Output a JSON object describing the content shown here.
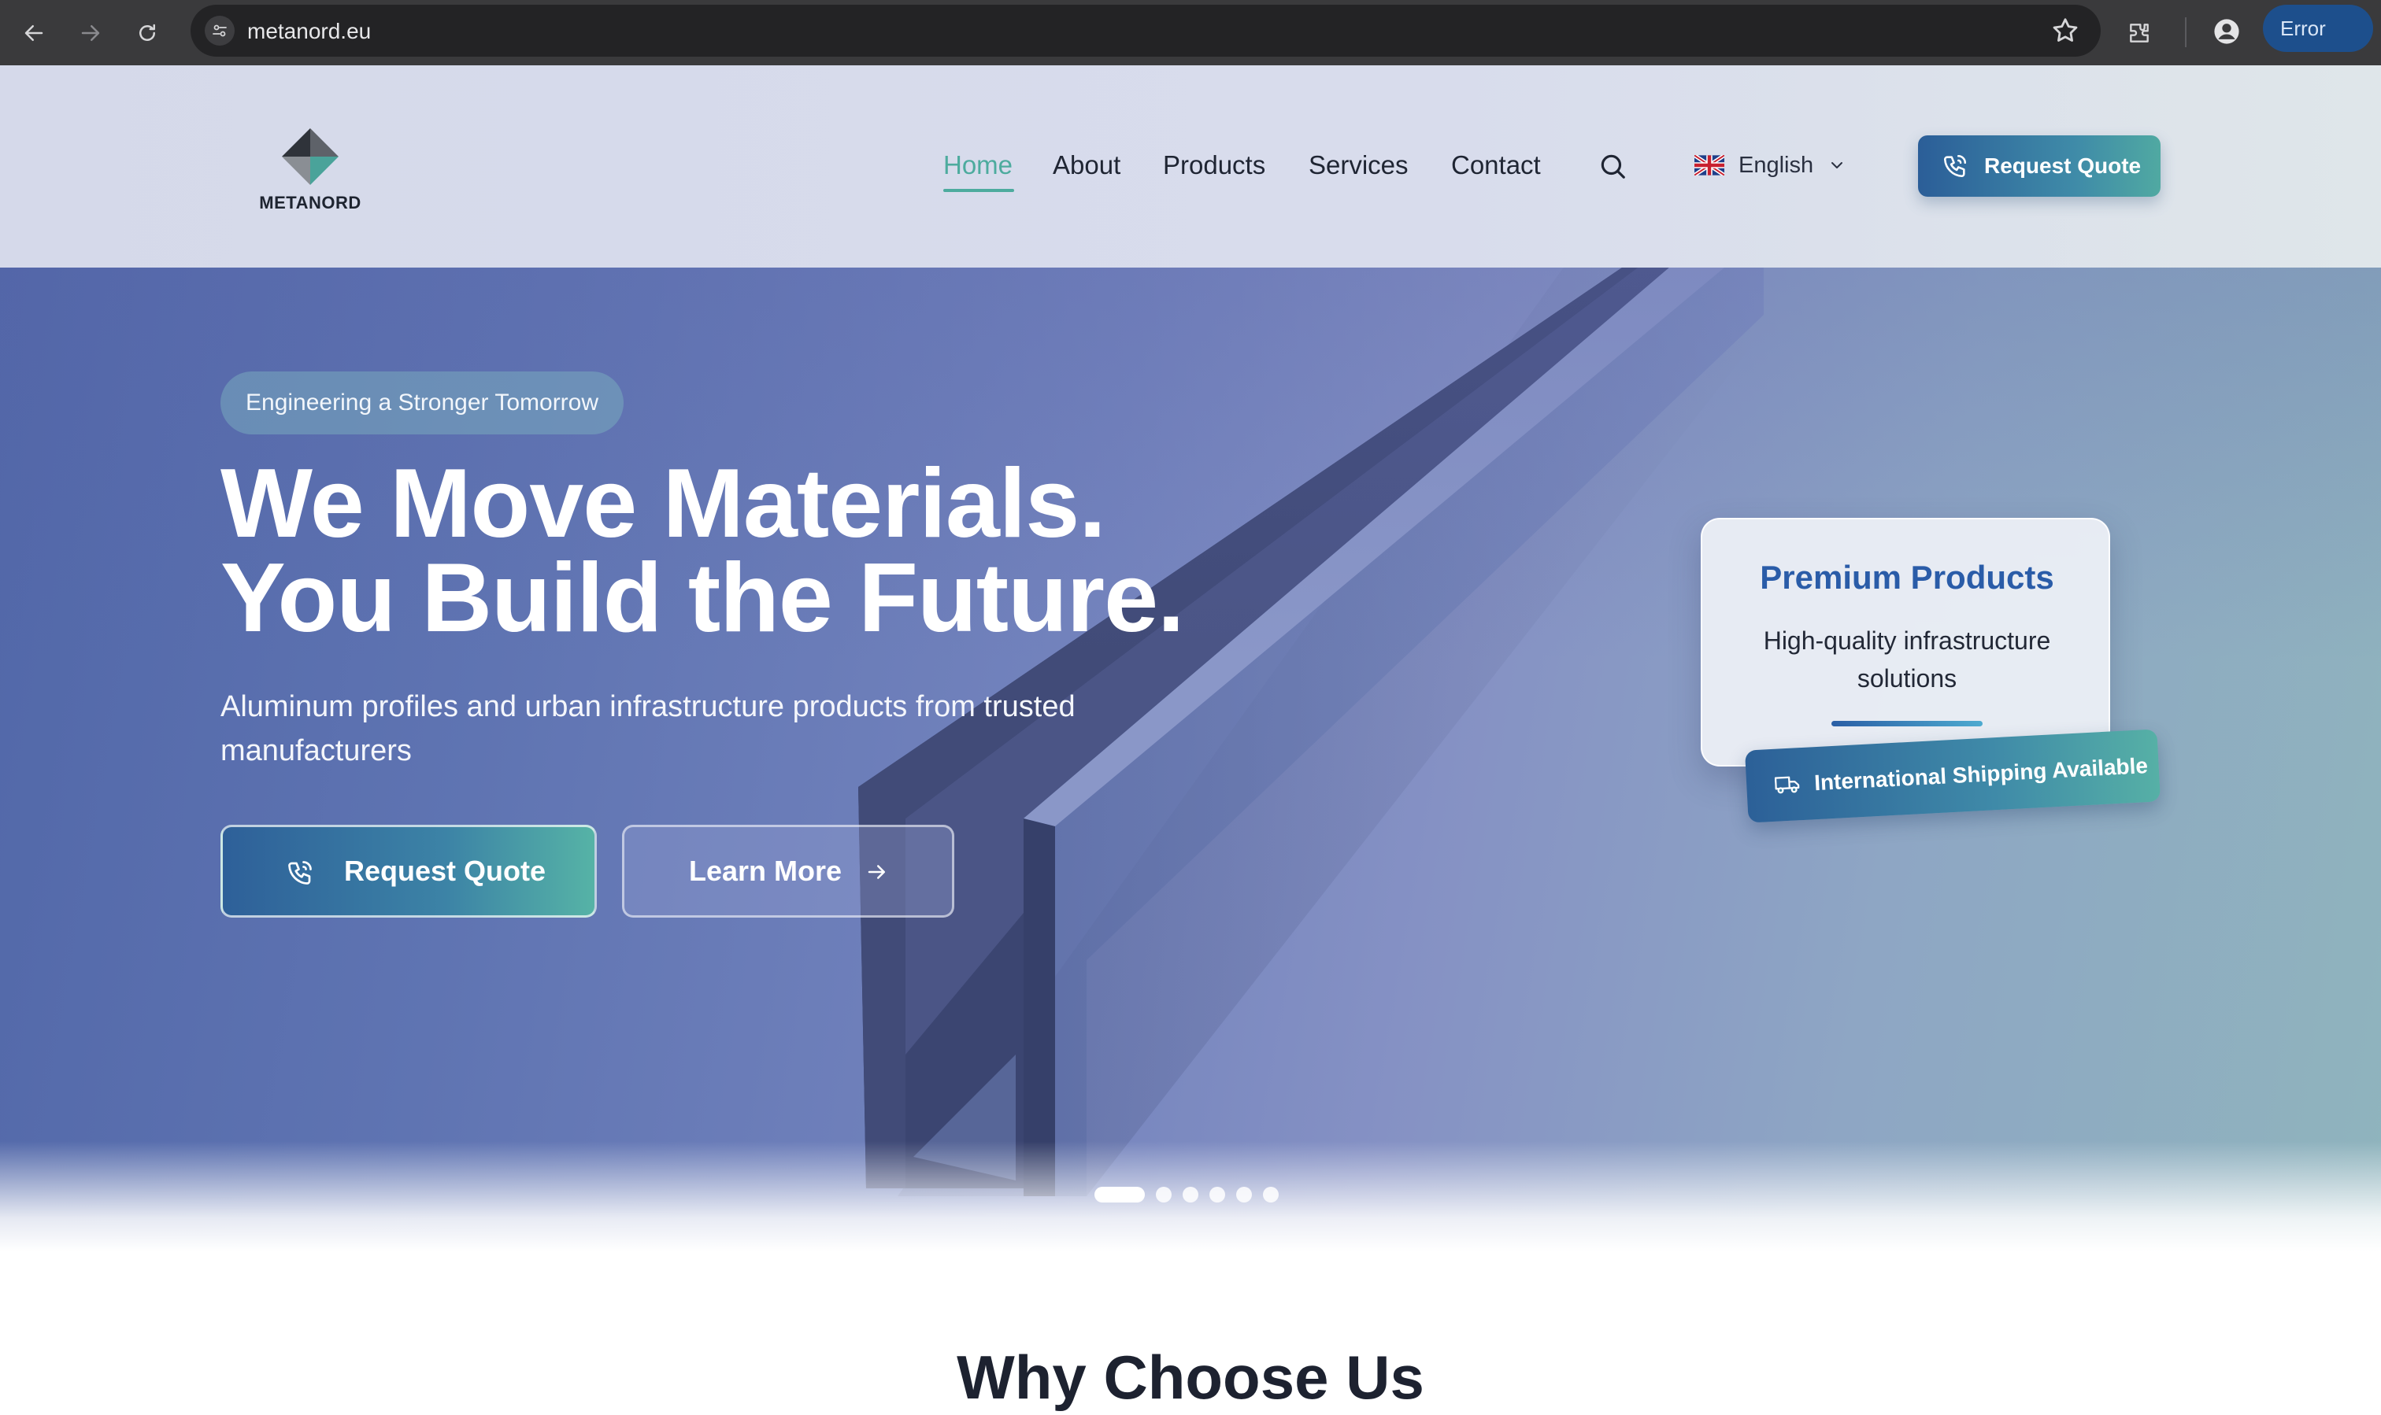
{
  "browser": {
    "url": "metanord.eu",
    "status_label": "Error",
    "icons": [
      "back-icon",
      "forward-icon",
      "reload-icon",
      "site-settings-icon",
      "bookmark-star-icon",
      "extensions-icon",
      "profile-icon",
      "more-menu-icon"
    ]
  },
  "header": {
    "logo_text": "METANORD",
    "nav": [
      {
        "label": "Home",
        "active": true
      },
      {
        "label": "About",
        "active": false
      },
      {
        "label": "Products",
        "active": false
      },
      {
        "label": "Services",
        "active": false
      },
      {
        "label": "Contact",
        "active": false
      }
    ],
    "language": "English",
    "cta_label": "Request Quote",
    "accent_color": "#4dab9e"
  },
  "hero": {
    "eyebrow": "Engineering a Stronger Tomorrow",
    "title_line1": "We Move Materials.",
    "title_line2": "You Build the Future.",
    "subtitle": "Aluminum profiles and urban infrastructure products from trusted manufacturers",
    "primary_button": "Request Quote",
    "secondary_button": "Learn More",
    "card": {
      "title": "Premium Products",
      "text": "High-quality infrastructure solutions"
    },
    "shipping_badge": "International Shipping Available",
    "slides": {
      "count": 6,
      "active_index": 0
    }
  },
  "section": {
    "title": "Why Choose Us"
  }
}
